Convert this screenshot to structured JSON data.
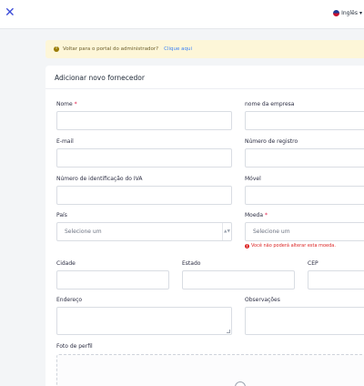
{
  "topbar": {
    "close_glyph": "✕",
    "language": "Inglês",
    "language_chevron": "▾"
  },
  "banner": {
    "text": "Voltar para o portal do administrador?",
    "link": "Clique aqui"
  },
  "form": {
    "title": "Adicionar novo fornecedor",
    "fields": {
      "name": {
        "label": "Nome",
        "required": "*"
      },
      "company": {
        "label": "nome da empresa"
      },
      "email": {
        "label": "E-mail"
      },
      "registration": {
        "label": "Número de registro"
      },
      "vat": {
        "label": "Número de identificação do IVA"
      },
      "mobile": {
        "label": "Móvel"
      },
      "country": {
        "label": "País",
        "placeholder": "Selecione um"
      },
      "currency": {
        "label": "Moeda",
        "required": "*",
        "placeholder": "Selecione um",
        "error": "Você não poderá alterar esta moeda."
      },
      "city": {
        "label": "Cidade"
      },
      "state": {
        "label": "Estado"
      },
      "zip": {
        "label": "CEP"
      },
      "address": {
        "label": "Endereço"
      },
      "notes": {
        "label": "Observações"
      },
      "photo": {
        "label": "Foto de perfil"
      }
    }
  },
  "icons": {
    "close": "close-icon",
    "flag": "us-flag-icon",
    "warning": "warning-icon",
    "error": "error-icon",
    "upload": "upload-icon"
  },
  "colors": {
    "accent": "#3b4bd8",
    "banner_bg": "#fdf6d8",
    "error": "#dc2626",
    "required": "#e11d48"
  }
}
